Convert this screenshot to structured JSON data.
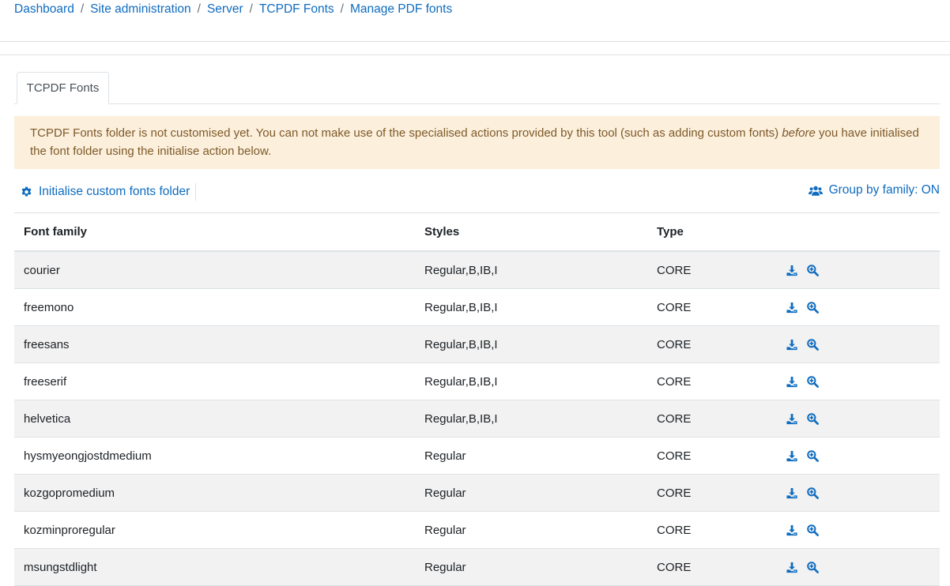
{
  "breadcrumb": [
    {
      "label": "Dashboard"
    },
    {
      "label": "Site administration"
    },
    {
      "label": "Server"
    },
    {
      "label": "TCPDF Fonts"
    },
    {
      "label": "Manage PDF fonts"
    }
  ],
  "breadcrumb_separator": "/",
  "tabs": [
    {
      "label": "TCPDF Fonts",
      "active": true
    }
  ],
  "alert": {
    "text_before": "TCPDF Fonts folder is not customised yet. You can not make use of the specialised actions provided by this tool (such as adding custom fonts) ",
    "text_emphasis": "before",
    "text_after": " you have initialised the font folder using the initialise action below."
  },
  "actions": {
    "initialise_label": "Initialise custom fonts folder",
    "initialise_icon": "gear-icon",
    "group_label": "Group by family: ON",
    "group_icon": "users-icon"
  },
  "table": {
    "headers": {
      "family": "Font family",
      "styles": "Styles",
      "type": "Type",
      "actions": ""
    },
    "rows": [
      {
        "family": "courier",
        "styles": "Regular,B,IB,I",
        "type": "CORE"
      },
      {
        "family": "freemono",
        "styles": "Regular,B,IB,I",
        "type": "CORE"
      },
      {
        "family": "freesans",
        "styles": "Regular,B,IB,I",
        "type": "CORE"
      },
      {
        "family": "freeserif",
        "styles": "Regular,B,IB,I",
        "type": "CORE"
      },
      {
        "family": "helvetica",
        "styles": "Regular,B,IB,I",
        "type": "CORE"
      },
      {
        "family": "hysmyeongjostdmedium",
        "styles": "Regular",
        "type": "CORE"
      },
      {
        "family": "kozgopromedium",
        "styles": "Regular",
        "type": "CORE"
      },
      {
        "family": "kozminproregular",
        "styles": "Regular",
        "type": "CORE"
      },
      {
        "family": "msungstdlight",
        "styles": "Regular",
        "type": "CORE"
      }
    ],
    "row_action_icons": [
      "download-icon",
      "zoom-in-icon"
    ]
  },
  "colors": {
    "link": "#0f6cbf",
    "alert_bg": "#fcefdc",
    "alert_text": "#7d5a29",
    "row_stripe": "#f2f2f2",
    "border": "#dee2e6"
  }
}
